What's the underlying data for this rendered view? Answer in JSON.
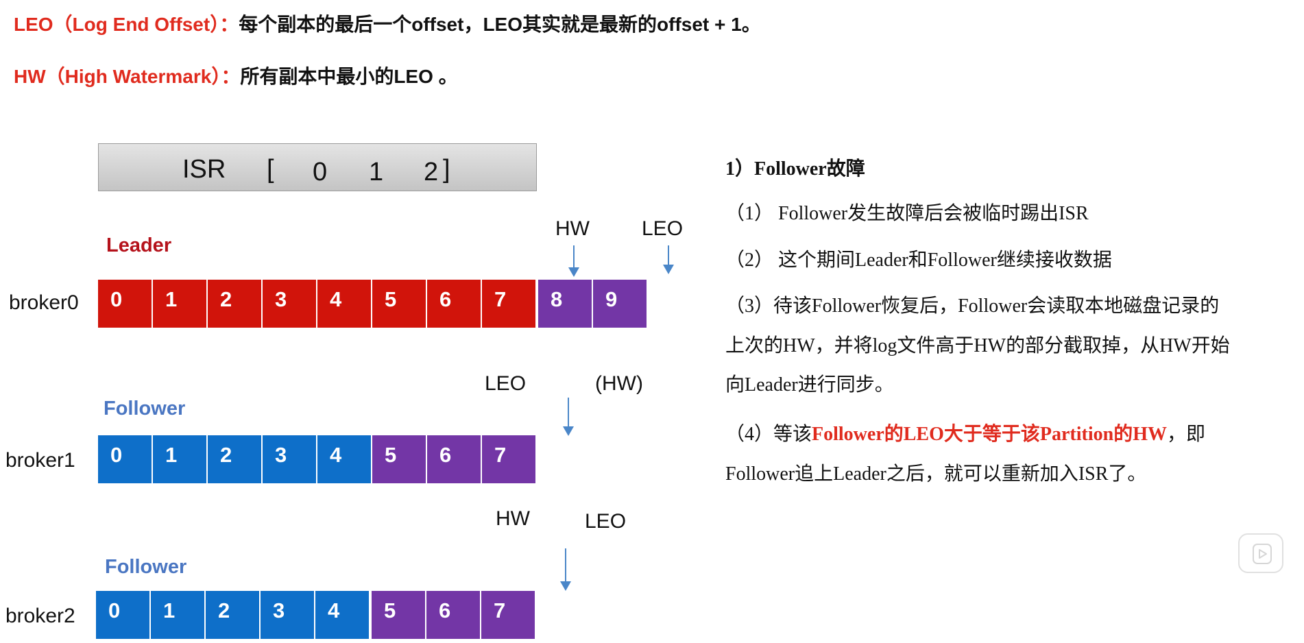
{
  "definitions": {
    "leo_term": "LEO（Log End Offset）：",
    "leo_text": "每个副本的最后一个offset，LEO其实就是最新的offset + 1。",
    "hw_term": "HW（High Watermark）：",
    "hw_text": "所有副本中最小的LEO 。"
  },
  "isr": {
    "label": "ISR",
    "open_bracket": "[",
    "replicas": [
      "0",
      "1",
      "2"
    ],
    "close_bracket": "]"
  },
  "brokers": [
    {
      "name": "broker0",
      "role": "Leader",
      "cells": [
        "0",
        "1",
        "2",
        "3",
        "4",
        "5",
        "6",
        "7",
        "8",
        "9"
      ],
      "markers": [
        "HW",
        "LEO"
      ]
    },
    {
      "name": "broker1",
      "role": "Follower",
      "cells": [
        "0",
        "1",
        "2",
        "3",
        "4",
        "5",
        "6",
        "7"
      ],
      "markers": [
        "LEO",
        "(HW)"
      ]
    },
    {
      "name": "broker2",
      "role": "Follower",
      "cells": [
        "0",
        "1",
        "2",
        "3",
        "4",
        "5",
        "6",
        "7"
      ],
      "markers": [
        "HW",
        "LEO"
      ]
    }
  ],
  "explanation": {
    "title": "1）Follower故障",
    "p1": "（1） Follower发生故障后会被临时踢出ISR",
    "p2": "（2） 这个期间Leader和Follower继续接收数据",
    "p3_line1": "（3）待该Follower恢复后，Follower会读取本地磁盘记录的",
    "p3_line2": "上次的HW，并将log文件高于HW的部分截取掉，从HW开始",
    "p3_line3": "向Leader进行同步。",
    "p4_prefix": "（4）等该",
    "p4_highlight": "Follower的LEO大于等于该Partition的HW",
    "p4_suffix": "，即",
    "p4_line2": "Follower追上Leader之后，就可以重新加入ISR了。"
  },
  "colors": {
    "term_red": "#e02b1e",
    "leader_red": "#d1140b",
    "follower_blue": "#0e6fc9",
    "unsynced_purple": "#7336a6",
    "arrow_blue": "#4a86c8"
  },
  "icons": [
    "down-arrow-icon",
    "play-icon"
  ]
}
